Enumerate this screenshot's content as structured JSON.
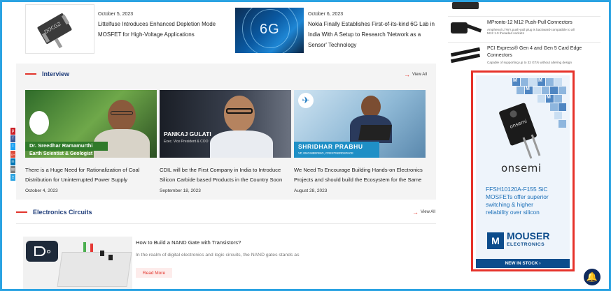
{
  "news": [
    {
      "date": "October 5, 2023",
      "line1": "Littelfuse Introduces Enhanced Depletion Mode",
      "line2": "MOSFET for High-Voltage Applications",
      "thumb_text": "DOCGZ"
    },
    {
      "date": "October 6, 2023",
      "line1": "Nokia Finally Establishes First-of-its-kind 6G Lab in",
      "line2": "India With A Setup to Research 'Network as a",
      "line3": "Sensor' Technology",
      "thumb_text": "6G"
    }
  ],
  "interview": {
    "title": "Interview",
    "view_all": "View All",
    "cards": [
      {
        "name_tag": "Dr. Sreedhar Ramamurthi",
        "tag2": "Earth Scientist & Geologist",
        "caption1": "There is a Huge Need for Rationalization of Coal",
        "caption2": "Distribution for Uninterrupted Power Supply",
        "date": "October 4, 2023"
      },
      {
        "name_tag": "PANKAJ GULATI",
        "tag2": "Exec. Vice President & COO",
        "caption1": "CDIL will be the First Company in India to Introduce",
        "caption2": "Silicon Carbide based Products in the Country Soon",
        "date": "September 18, 2023"
      },
      {
        "name_tag": "SHRIDHAR PRABHU",
        "tag2": "VP, ENGINEERING, CRESTNERDSPACE",
        "caption1": "We Need To Encourage Building Hands-on Electronics",
        "caption2": "Projects and should build the Ecosystem for the Same",
        "date": "August 28, 2023"
      }
    ]
  },
  "electronics": {
    "title": "Electronics Circuits",
    "view_all": "View All",
    "article_title": "How to Build a NAND Gate with Transistors?",
    "article_desc": "In the realm of digital electronics and logic circuits, the NAND gates stands as",
    "read_more": "Read More"
  },
  "products": [
    {
      "title": "MPronto-12 M12 Push-Pull Connectors",
      "sub1": "Amphenol LTW's push-pull plug is backward-compatible to all",
      "sub2": "M12 1.0 threaded sockets"
    },
    {
      "title1": "PCI Express® Gen 4 and Gen 5 Card Edge",
      "title2": "Connectors",
      "sub": "Capable of supporting up to 32 GT/s without altering design"
    }
  ],
  "ad": {
    "brand": "onsemi",
    "line1": "FFSH10120A-F155 SiC",
    "line2": "MOSFETs offer superior",
    "line3": "switching & higher",
    "line4": "reliability over silicon",
    "mouser_letter": "M",
    "mouser": "MOUSER",
    "mouser_sub": "ELECTRONICS",
    "cta": "NEW IN STOCK ›",
    "chip_text": "onsemi",
    "cube_letter": "M"
  },
  "social": [
    "p",
    "f",
    "t",
    "G+",
    "in",
    "✉",
    "⇪"
  ],
  "colors": {
    "accent": "#e2342c",
    "heading": "#1f3d7a",
    "frame": "#2ba3e2",
    "mouser": "#0c4c8c"
  }
}
